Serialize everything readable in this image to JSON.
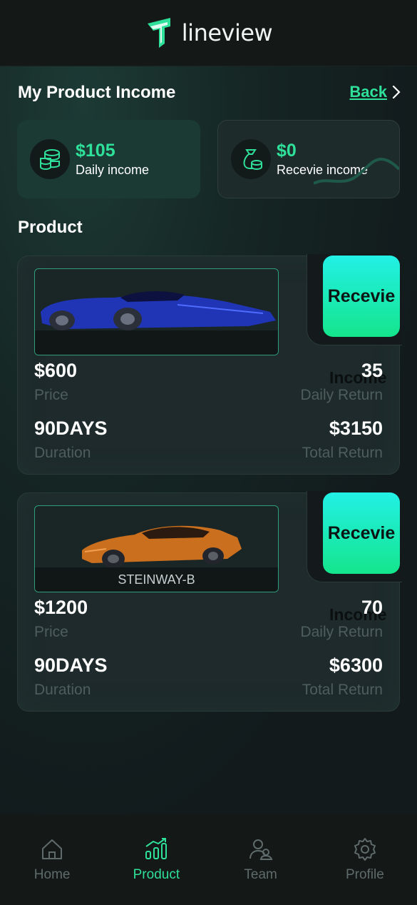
{
  "app": {
    "name": "lineview"
  },
  "page": {
    "title": "My Product Income",
    "back_label": "Back"
  },
  "stats": {
    "daily": {
      "amount": "$105",
      "label": "Daily income",
      "icon": "coins-stack-icon"
    },
    "receive": {
      "amount": "$0",
      "label": "Recevie income",
      "icon": "money-bag-icon"
    }
  },
  "section": {
    "title": "Product"
  },
  "products": [
    {
      "car_label": "",
      "car_color": "#2340c8",
      "price": "$600",
      "price_label": "Price",
      "daily_return": "35",
      "daily_return_label": "Daily Return",
      "duration": "90DAYS",
      "duration_label": "Duration",
      "total_return": "$3150",
      "total_return_label": "Total Return",
      "button_label": "Recevie",
      "button_overlay": "Income"
    },
    {
      "car_label": "STEINWAY-B",
      "car_color": "#d07a22",
      "price": "$1200",
      "price_label": "Price",
      "daily_return": "70",
      "daily_return_label": "Daily Return",
      "duration": "90DAYS",
      "duration_label": "Duration",
      "total_return": "$6300",
      "total_return_label": "Total Return",
      "button_label": "Recevie",
      "button_overlay": "Income"
    }
  ],
  "nav": [
    {
      "label": "Home",
      "icon": "home-icon",
      "active": false
    },
    {
      "label": "Product",
      "icon": "bar-chart-icon",
      "active": true
    },
    {
      "label": "Team",
      "icon": "team-icon",
      "active": false
    },
    {
      "label": "Profile",
      "icon": "gear-icon",
      "active": false
    }
  ],
  "colors": {
    "accent": "#2fe09a",
    "background": "#14191b",
    "button_top": "#22f0e6",
    "button_bottom": "#14e58c"
  }
}
